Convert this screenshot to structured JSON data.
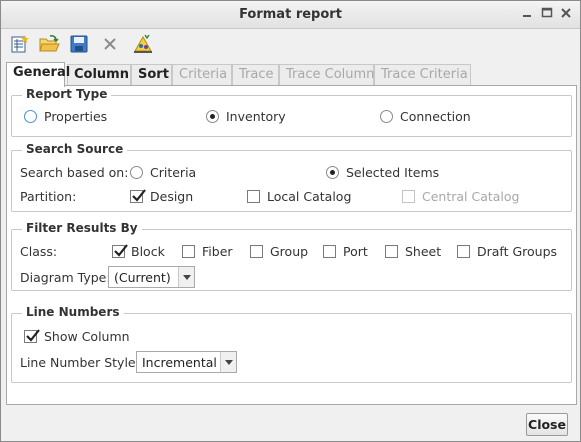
{
  "window": {
    "title": "Format report"
  },
  "toolbar": {
    "buttons": [
      {
        "icon": "new-report-icon"
      },
      {
        "icon": "open-folder-icon"
      },
      {
        "icon": "save-icon"
      },
      {
        "icon": "delete-icon"
      },
      {
        "icon": "run-report-icon"
      }
    ]
  },
  "tabs": [
    {
      "label": "General",
      "state": "active"
    },
    {
      "label": "Column",
      "state": "enabled"
    },
    {
      "label": "Sort",
      "state": "enabled"
    },
    {
      "label": "Criteria",
      "state": "disabled"
    },
    {
      "label": "Trace",
      "state": "disabled"
    },
    {
      "label": "Trace Column",
      "state": "disabled"
    },
    {
      "label": "Trace Criteria",
      "state": "disabled"
    }
  ],
  "report_type": {
    "legend": "Report Type",
    "options": [
      "Properties",
      "Inventory",
      "Connection"
    ],
    "selected": "Inventory"
  },
  "search_source": {
    "legend": "Search Source",
    "based_on_label": "Search based on:",
    "based_on_options": [
      "Criteria",
      "Selected Items"
    ],
    "based_on_selected": "Selected Items",
    "partition_label": "Partition:",
    "partitions": [
      {
        "label": "Design",
        "checked": true,
        "enabled": true
      },
      {
        "label": "Local Catalog",
        "checked": false,
        "enabled": true
      },
      {
        "label": "Central Catalog",
        "checked": false,
        "enabled": false
      }
    ]
  },
  "filter_results": {
    "legend": "Filter Results By",
    "class_label": "Class:",
    "classes": [
      {
        "label": "Block",
        "checked": true
      },
      {
        "label": "Fiber",
        "checked": false
      },
      {
        "label": "Group",
        "checked": false
      },
      {
        "label": "Port",
        "checked": false
      },
      {
        "label": "Sheet",
        "checked": false
      },
      {
        "label": "Draft Groups",
        "checked": false
      }
    ],
    "diagram_type_label": "Diagram Type:",
    "diagram_type_value": "(Current)"
  },
  "line_numbers": {
    "legend": "Line Numbers",
    "show_column_label": "Show Column",
    "show_column_checked": true,
    "style_label": "Line Number Style:",
    "style_value": "Incremental"
  },
  "footer": {
    "close_label": "Close"
  },
  "colors": {
    "accent_blue": "#4a90d9",
    "panel_bg": "#ffffff",
    "window_bg": "#f0f0f0"
  }
}
